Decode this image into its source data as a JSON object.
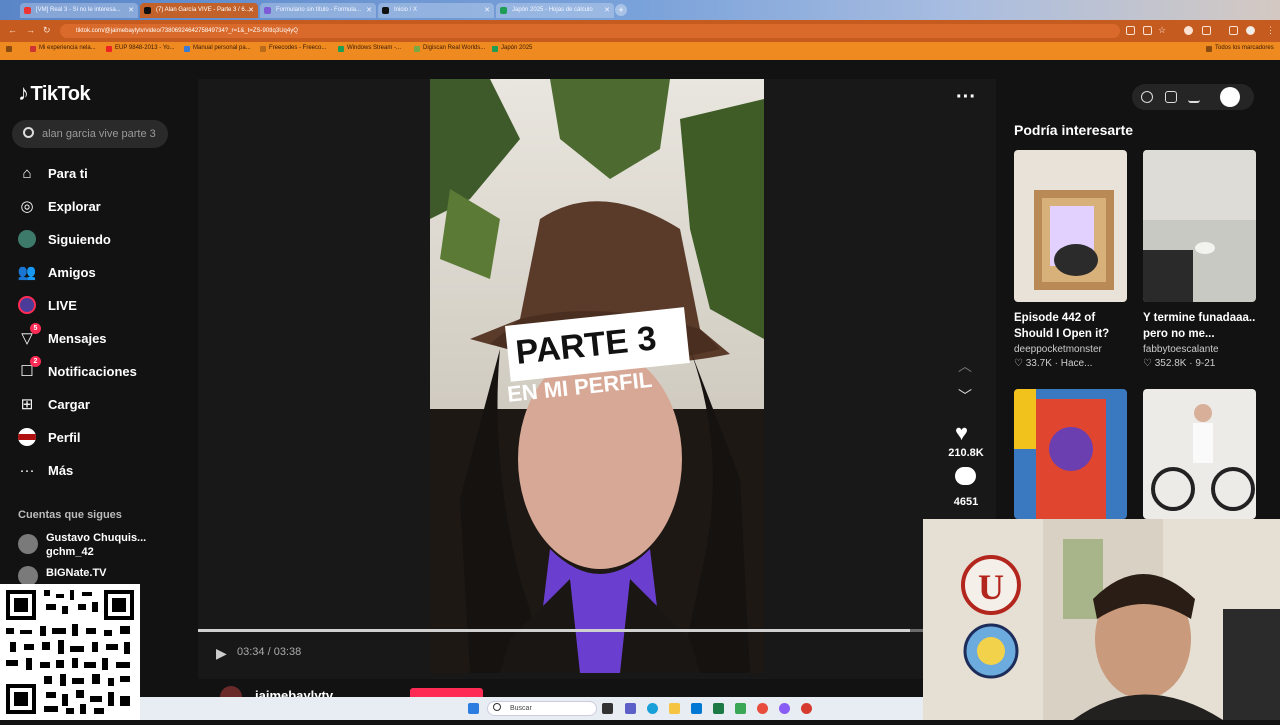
{
  "browser": {
    "tabs": [
      {
        "label": "[VM] Real 3 - Si no le interesa...",
        "active": false,
        "favicon_color": "#e33"
      },
      {
        "label": "(7) Alan García VIVE - Parte 3 / 6...",
        "active": true,
        "favicon_color": "#111"
      },
      {
        "label": "Formulario sin título - Formula...",
        "active": false,
        "favicon_color": "#7b5bd6"
      },
      {
        "label": "Inicio / X",
        "active": false,
        "favicon_color": "#111"
      },
      {
        "label": "Japón 2025 - Hojas de cálculo",
        "active": false,
        "favicon_color": "#1e9d57"
      }
    ],
    "url": "tiktok.com/@jaimebaylytv/video/7380692464275849734?_r=1&_t=ZS-90tIq3Uq4yQ",
    "bookmarks": [
      {
        "label": "Mi experiencia nela...",
        "color": "#c33"
      },
      {
        "label": "EUP 9848-2013 - Yo...",
        "color": "#e22"
      },
      {
        "label": "Manual personal pa...",
        "color": "#3a7bd5"
      },
      {
        "label": "Freecodes - Freeco...",
        "color": "#b86a1a"
      },
      {
        "label": "Windows Stream -...",
        "color": "#1e9d57"
      },
      {
        "label": "Digiscan Real Worlds...",
        "color": "#7a4"
      },
      {
        "label": "Japón 2025",
        "color": "#1e9d57"
      }
    ],
    "bookmarks_other": "Todos los marcadores"
  },
  "tiktok": {
    "logo_text": "TikTok",
    "search_placeholder": "alan garcia vive parte 3",
    "nav": [
      {
        "label": "Para ti",
        "icon": "home-icon",
        "badge": ""
      },
      {
        "label": "Explorar",
        "icon": "compass-icon",
        "badge": ""
      },
      {
        "label": "Siguiendo",
        "icon": "avatar-icon",
        "badge": ""
      },
      {
        "label": "Amigos",
        "icon": "friends-icon",
        "badge": ""
      },
      {
        "label": "LIVE",
        "icon": "live-icon",
        "badge": ""
      },
      {
        "label": "Mensajes",
        "icon": "messages-icon",
        "badge": "5"
      },
      {
        "label": "Notificaciones",
        "icon": "inbox-icon",
        "badge": "2"
      },
      {
        "label": "Cargar",
        "icon": "upload-icon",
        "badge": ""
      },
      {
        "label": "Perfil",
        "icon": "profile-icon",
        "badge": ""
      },
      {
        "label": "Más",
        "icon": "more-icon",
        "badge": ""
      }
    ],
    "following_title": "Cuentas que sigues",
    "following": [
      {
        "name": "Gustavo Chuquis...",
        "handle": "gchm_42"
      },
      {
        "name": "BIGNate.TV",
        "handle": ""
      }
    ],
    "video": {
      "overlay_line1": "PARTE 3",
      "overlay_line2": "EN MI PERFIL",
      "likes": "210.8K",
      "comments": "4651",
      "time": "03:34 / 03:38",
      "progress": 0.982,
      "author": "jaimebaylytv"
    },
    "rail_title": "Podría interesarte",
    "recommendations": [
      {
        "title": "Episode 442 of Should I Open it? O...",
        "author": "deeppocketmonster",
        "stats": "♡ 33.7K · Hace..."
      },
      {
        "title": "Y termine funadaaa.. pero no me...",
        "author": "fabbytoescalante",
        "stats": "♡ 352.8K · 9-21"
      },
      {
        "title": "",
        "author": "",
        "stats": ""
      },
      {
        "title": "",
        "author": "",
        "stats": ""
      }
    ]
  },
  "taskbar": {
    "search_placeholder": "Buscar"
  }
}
